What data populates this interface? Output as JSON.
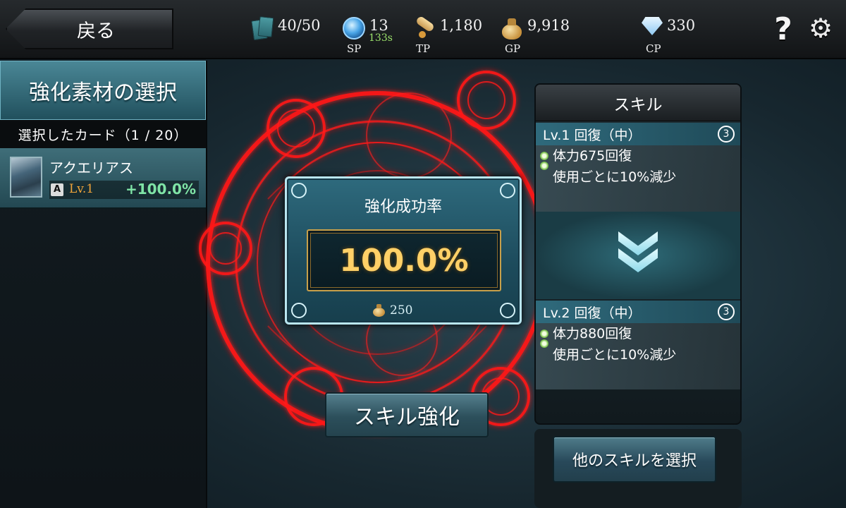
{
  "header": {
    "back_label": "戻る",
    "cards": "40/50",
    "sp": "13",
    "sp_timer": "133s",
    "sp_label": "SP",
    "tp": "1,180",
    "tp_label": "TP",
    "gp": "9,918",
    "gp_label": "GP",
    "cp": "330",
    "cp_label": "CP"
  },
  "left": {
    "title": "強化素材の選択",
    "selected": "選択したカード（1 / 20）",
    "card": {
      "name": "アクエリアス",
      "rank": "A",
      "level": "Lv.1",
      "rate": "+100.0%"
    }
  },
  "success": {
    "title": "強化成功率",
    "rate": "100.0%",
    "cost": "250"
  },
  "enhance_button": "スキル強化",
  "skill": {
    "header": "スキル",
    "current": {
      "name": "Lv.1 回復（中）",
      "num": "3",
      "line1": "体力675回復",
      "line2": "使用ごとに10%減少"
    },
    "next": {
      "name": "Lv.2 回復（中）",
      "num": "3",
      "line1": "体力880回復",
      "line2": "使用ごとに10%減少"
    }
  },
  "select_button": "他のスキルを選択",
  "colors": {
    "accent_teal": "#2f6a7c",
    "gold": "#ffd067",
    "magic_red": "#ff1a1a"
  }
}
